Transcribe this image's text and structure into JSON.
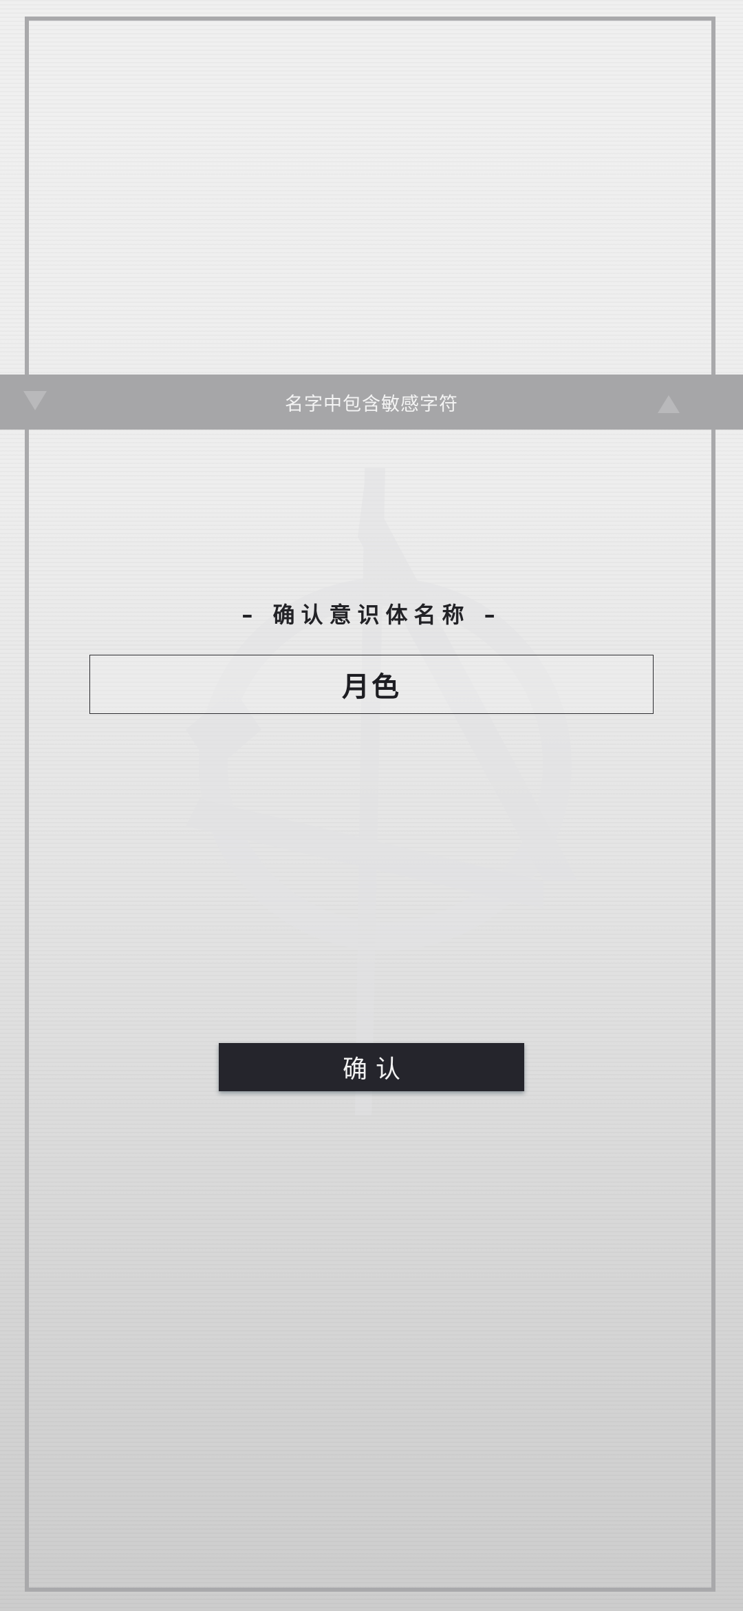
{
  "toast": {
    "message": "名字中包含敏感字符"
  },
  "dialog": {
    "title": "– 确认意识体名称 –",
    "name_value": "月色",
    "confirm_label": "确认"
  },
  "colors": {
    "button_bg": "#25252c",
    "toast_bg": "#a6a6a8",
    "frame_border": "#a9a9ab"
  },
  "icons": {
    "background_emblem": "faction-emblem-icon",
    "toast_left": "triangle-down-icon",
    "toast_right": "triangle-up-icon"
  }
}
